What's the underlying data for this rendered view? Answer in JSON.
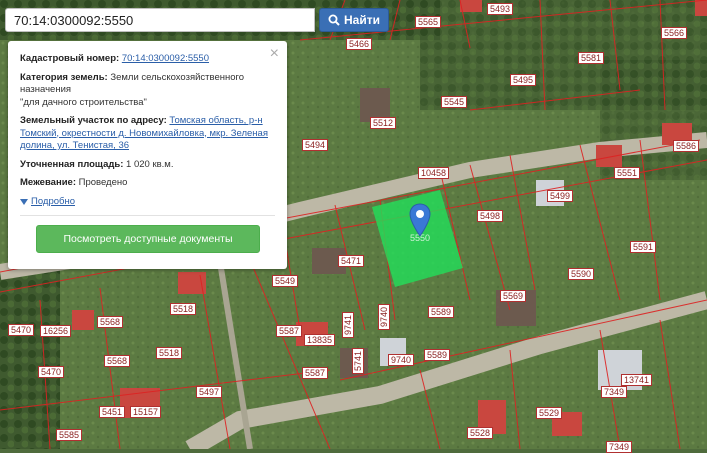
{
  "search": {
    "value": "70:14:0300092:5550",
    "button_label": "Найти"
  },
  "popup": {
    "cadastral_label": "Кадастровый номер:",
    "cadastral_value": "70:14:0300092:5550",
    "category_label": "Категория земель:",
    "category_value_1": "Земли сельскохозяйственного назначения",
    "category_value_2": "\"для дачного строительства\"",
    "address_label": "Земельный участок по адресу:",
    "address_value": "Томская область, р-н Томский, окрестности д. Новомихайловка, мкр. Зеленая долина, ул. Тенистая, 36",
    "area_label": "Уточненная площадь:",
    "area_value": "1 020 кв.м.",
    "survey_label": "Межевание:",
    "survey_value": "Проведено",
    "more_label": "Подробно",
    "docs_button": "Посмотреть доступные документы"
  },
  "highlight_color": "#22e05a",
  "plot_labels": [
    "5565",
    "5493",
    "5466",
    "5495",
    "5581",
    "5566",
    "5545",
    "5512",
    "10458",
    "5586",
    "5494",
    "5551",
    "5499",
    "5498",
    "5591",
    "5471",
    "5549",
    "5569",
    "5590",
    "5518",
    "5568",
    "5470",
    "16256",
    "5589",
    "9741",
    "9740",
    "5587",
    "13835",
    "5568",
    "5518",
    "5470",
    "5451",
    "15157",
    "5497",
    "5587",
    "5741",
    "9740",
    "5589",
    "5585",
    "5529",
    "5528",
    "13741",
    "7349",
    "7349",
    "5550"
  ]
}
